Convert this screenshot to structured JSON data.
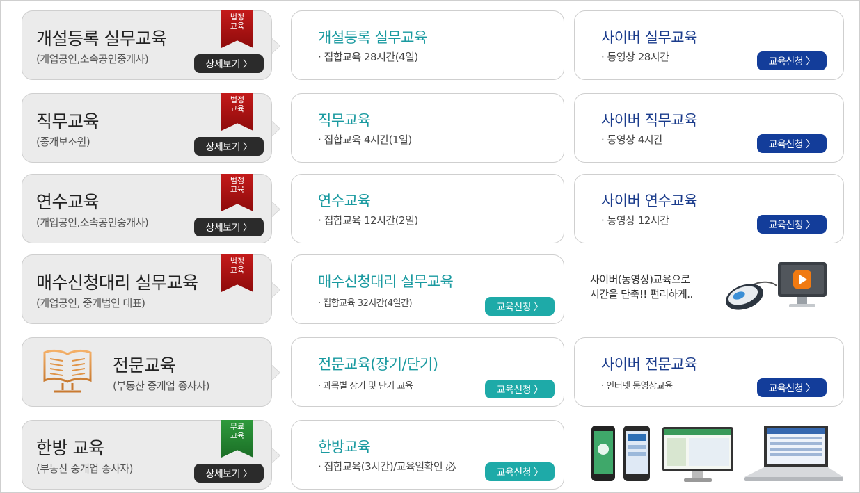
{
  "badges": {
    "legal": [
      "법정",
      "교육"
    ],
    "free": [
      "무료",
      "교육"
    ]
  },
  "labels": {
    "detail": "상세보기 〉",
    "apply": "교육신청 〉"
  },
  "rows": [
    {
      "category": {
        "title": "개설등록 실무교육",
        "subtitle": "(개업공인,소속공인중개사)"
      },
      "offline": {
        "title": "개설등록 실무교육",
        "desc": "· 집합교육 28시간(4일)"
      },
      "cyber": {
        "title": "사이버 실무교육",
        "desc": "· 동영상 28시간"
      }
    },
    {
      "category": {
        "title": "직무교육",
        "subtitle": "(중개보조원)"
      },
      "offline": {
        "title": "직무교육",
        "desc": "· 집합교육 4시간(1일)"
      },
      "cyber": {
        "title": "사이버 직무교육",
        "desc": "· 동영상 4시간"
      }
    },
    {
      "category": {
        "title": "연수교육",
        "subtitle": "(개업공인,소속공인중개사)"
      },
      "offline": {
        "title": "연수교육",
        "desc": "· 집합교육 12시간(2일)"
      },
      "cyber": {
        "title": "사이버 연수교육",
        "desc": "· 동영상 12시간"
      }
    },
    {
      "category": {
        "title": "매수신청대리 실무교육",
        "subtitle": "(개업공인, 중개법인 대표)"
      },
      "offline": {
        "title": "매수신청대리 실무교육",
        "desc": "· 집합교육 32시간(4일간)"
      },
      "promo": [
        "사이버(동영상)교육으로",
        "시간을 단축!! 편리하게.."
      ]
    },
    {
      "category": {
        "title": "전문교육",
        "subtitle": "(부동산 중개업 종사자)"
      },
      "offline": {
        "title": "전문교육(장기/단기)",
        "desc": "· 과목별 장기 및 단기 교육"
      },
      "cyber": {
        "title": "사이버 전문교육",
        "desc": "· 인터넷 동영상교육"
      }
    },
    {
      "category": {
        "title": "한방 교육",
        "subtitle": "(부동산 중개업 종사자)"
      },
      "offline": {
        "title": "한방교육",
        "desc": "· 집합교육(3시간)/교육일확인 必"
      }
    }
  ],
  "colors": {
    "teal": "#1eaaa8",
    "navy": "#133d9a",
    "ribbon_red": "#b01515",
    "ribbon_green": "#2a8a36"
  },
  "icons": [
    "book-icon",
    "mouse-monitor-play-icon",
    "devices-illustration"
  ]
}
